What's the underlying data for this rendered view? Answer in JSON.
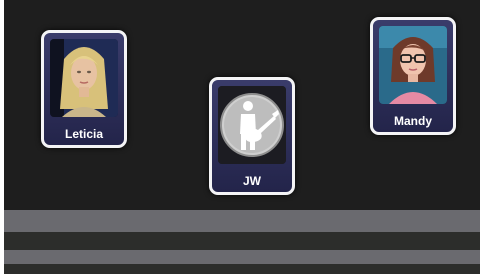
{
  "profiles": [
    {
      "name": "Leticia",
      "avatar": "blonde-woman-avatar"
    },
    {
      "name": "JW",
      "avatar": "guitarist-silhouette-icon"
    },
    {
      "name": "Mandy",
      "avatar": "woman-with-glasses-avatar"
    }
  ],
  "colors": {
    "background": "#1e1e1e",
    "card_fill": "#2b2d58",
    "card_border": "#f4f4f6",
    "floor_light": "#6a6a6f",
    "floor_dark": "#2c2d2b",
    "name_text": "#ffffff"
  }
}
